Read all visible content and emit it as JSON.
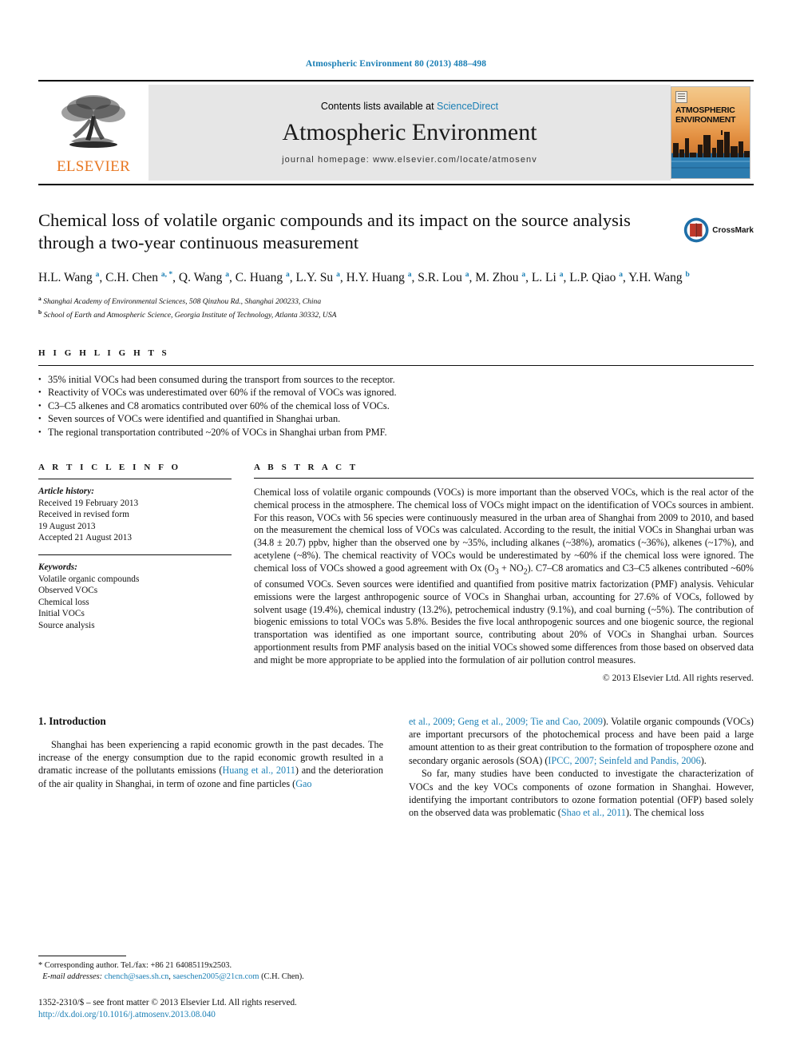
{
  "running_head": "Atmospheric Environment 80 (2013) 488–498",
  "masthead": {
    "contents_prefix": "Contents lists available at ",
    "contents_link": "ScienceDirect",
    "journal_name": "Atmospheric Environment",
    "homepage": "journal homepage: www.elsevier.com/locate/atmosenv",
    "publisher": "ELSEVIER",
    "cover_title_line1": "ATMOSPHERIC",
    "cover_title_line2": "ENVIRONMENT"
  },
  "article": {
    "title": "Chemical loss of volatile organic compounds and its impact on the source analysis through a two-year continuous measurement",
    "crossmark_label": "CrossMark",
    "authors": [
      {
        "name": "H.L. Wang",
        "sup": "a"
      },
      {
        "name": "C.H. Chen",
        "sup": "a, *"
      },
      {
        "name": "Q. Wang",
        "sup": "a"
      },
      {
        "name": "C. Huang",
        "sup": "a"
      },
      {
        "name": "L.Y. Su",
        "sup": "a"
      },
      {
        "name": "H.Y. Huang",
        "sup": "a"
      },
      {
        "name": "S.R. Lou",
        "sup": "a"
      },
      {
        "name": "M. Zhou",
        "sup": "a"
      },
      {
        "name": "L. Li",
        "sup": "a"
      },
      {
        "name": "L.P. Qiao",
        "sup": "a"
      },
      {
        "name": "Y.H. Wang",
        "sup": "b"
      }
    ],
    "affiliations": [
      {
        "sup": "a",
        "text": "Shanghai Academy of Environmental Sciences, 508 Qinzhou Rd., Shanghai 200233, China"
      },
      {
        "sup": "b",
        "text": "School of Earth and Atmospheric Science, Georgia Institute of Technology, Atlanta 30332, USA"
      }
    ]
  },
  "highlights": {
    "label": "H I G H L I G H T S",
    "items": [
      "35% initial VOCs had been consumed during the transport from sources to the receptor.",
      "Reactivity of VOCs was underestimated over 60% if the removal of VOCs was ignored.",
      "C3–C5 alkenes and C8 aromatics contributed over 60% of the chemical loss of VOCs.",
      "Seven sources of VOCs were identified and quantified in Shanghai urban.",
      "The regional transportation contributed ~20% of VOCs in Shanghai urban from PMF."
    ]
  },
  "article_info": {
    "label": "A R T I C L E  I N F O",
    "history_label": "Article history:",
    "history": [
      "Received 19 February 2013",
      "Received in revised form",
      "19 August 2013",
      "Accepted 21 August 2013"
    ],
    "keywords_label": "Keywords:",
    "keywords": [
      "Volatile organic compounds",
      "Observed VOCs",
      "Chemical loss",
      "Initial VOCs",
      "Source analysis"
    ]
  },
  "abstract": {
    "label": "A B S T R A C T",
    "text": "Chemical loss of volatile organic compounds (VOCs) is more important than the observed VOCs, which is the real actor of the chemical process in the atmosphere. The chemical loss of VOCs might impact on the identification of VOCs sources in ambient. For this reason, VOCs with 56 species were continuously measured in the urban area of Shanghai from 2009 to 2010, and based on the measurement the chemical loss of VOCs was calculated. According to the result, the initial VOCs in Shanghai urban was (34.8 ± 20.7) ppbv, higher than the observed one by ~35%, including alkanes (~38%), aromatics (~36%), alkenes (~17%), and acetylene (~8%). The chemical reactivity of VOCs would be underestimated by ~60% if the chemical loss were ignored. The chemical loss of VOCs showed a good agreement with Ox (O3 + NO2). C7–C8 aromatics and C3–C5 alkenes contributed ~60% of consumed VOCs. Seven sources were identified and quantified from positive matrix factorization (PMF) analysis. Vehicular emissions were the largest anthropogenic source of VOCs in Shanghai urban, accounting for 27.6% of VOCs, followed by solvent usage (19.4%), chemical industry (13.2%), petrochemical industry (9.1%), and coal burning (~5%). The contribution of biogenic emissions to total VOCs was 5.8%. Besides the five local anthropogenic sources and one biogenic source, the regional transportation was identified as one important source, contributing about 20% of VOCs in Shanghai urban. Sources apportionment results from PMF analysis based on the initial VOCs showed some differences from those based on observed data and might be more appropriate to be applied into the formulation of air pollution control measures.",
    "copyright": "© 2013 Elsevier Ltd. All rights reserved."
  },
  "introduction": {
    "heading": "1. Introduction",
    "left_para_1_a": "Shanghai has been experiencing a rapid economic growth in the past decades. The increase of the energy consumption due to the rapid economic growth resulted in a dramatic increase of the pollutants emissions (",
    "left_cite_1": "Huang et al., 2011",
    "left_para_1_b": ") and the deterioration of the air quality in Shanghai, in term of ozone and fine particles (",
    "left_cite_2": "Gao",
    "right_cite_1": "et al., 2009; Geng et al., 2009; Tie and Cao, 2009",
    "right_para_1_a": "). Volatile organic compounds (VOCs) are important precursors of the photochemical process and have been paid a large amount attention to as their great contribution to the formation of troposphere ozone and secondary organic aerosols (SOA) (",
    "right_cite_2": "IPCC, 2007; Seinfeld and Pandis, 2006",
    "right_para_1_b": ").",
    "right_para_2_a": "So far, many studies have been conducted to investigate the characterization of VOCs and the key VOCs components of ozone formation in Shanghai. However, identifying the important contributors to ozone formation potential (OFP) based solely on the observed data was problematic (",
    "right_cite_3": "Shao et al., 2011",
    "right_para_2_b": "). The chemical loss"
  },
  "footnotes": {
    "corresponding": "* Corresponding author. Tel./fax: +86 21 64085119x2503.",
    "email_label": "E-mail addresses:",
    "email_1": "chench@saes.sh.cn",
    "email_2": "saeschen2005@21cn.com",
    "email_suffix": "(C.H. Chen).",
    "imprint": "1352-2310/$ – see front matter © 2013 Elsevier Ltd. All rights reserved.",
    "doi": "http://dx.doi.org/10.1016/j.atmosenv.2013.08.040"
  },
  "colors": {
    "link": "#1a7fb5",
    "elsevier_orange": "#e87722",
    "masthead_grey": "#e6e6e6"
  }
}
